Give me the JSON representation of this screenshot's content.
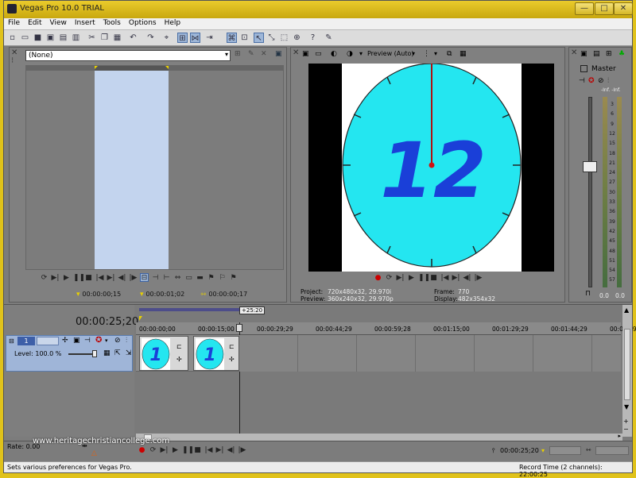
{
  "window": {
    "title": "Vegas Pro 10.0 TRIAL",
    "minimize": "—",
    "maximize": "□",
    "close": "✕"
  },
  "menu": [
    "File",
    "Edit",
    "View",
    "Insert",
    "Tools",
    "Options",
    "Help"
  ],
  "trimmer": {
    "dropdown_value": "(None)",
    "in_time": "00:00:00;15",
    "out_time": "00:00:01;02",
    "length_time": "00:00:00;17"
  },
  "preview": {
    "mode": "Preview (Auto)",
    "clock_number": "12",
    "project_label": "Project:",
    "project_value": "720x480x32, 29.970i",
    "preview_label": "Preview:",
    "preview_value": "360x240x32, 29.970p",
    "frame_label": "Frame:",
    "frame_value": "770",
    "display_label": "Display:",
    "display_value": "482x354x32"
  },
  "mixer": {
    "title": "Master",
    "scale": [
      "-Inf.",
      "-Inf.",
      "3",
      "6",
      "9",
      "12",
      "15",
      "18",
      "21",
      "24",
      "27",
      "30",
      "33",
      "36",
      "39",
      "42",
      "45",
      "48",
      "51",
      "54",
      "57"
    ],
    "left_value": "0.0",
    "right_value": "0.0"
  },
  "timeline": {
    "cursor_time": "00:00:25;20",
    "cursor_flag": "+25:20",
    "ruler": [
      "00:00:00;00",
      "00:00:15;00",
      "00:00:29;29",
      "00:00:44;29",
      "00:00:59;28",
      "00:01:15;00",
      "00:01:29;29",
      "00:01:44;29",
      "00:01:59;28"
    ],
    "track_number": "1",
    "track_level": "Level: 100.0 %",
    "clip_numbers": [
      "1",
      "1"
    ]
  },
  "transport": {
    "rate_label": "Rate: 0.00",
    "time": "00:00:25;20"
  },
  "watermark": "www.heritagechristiancollege.com",
  "status": {
    "message": "Sets various preferences for Vegas Pro.",
    "record_time": "Record Time (2 channels): 22:00:25"
  },
  "colors": {
    "accent": "#1a3fd8",
    "clock_face": "#24e6f0",
    "selection": "#c3d4ee",
    "track_selected": "#9fb5d8"
  }
}
